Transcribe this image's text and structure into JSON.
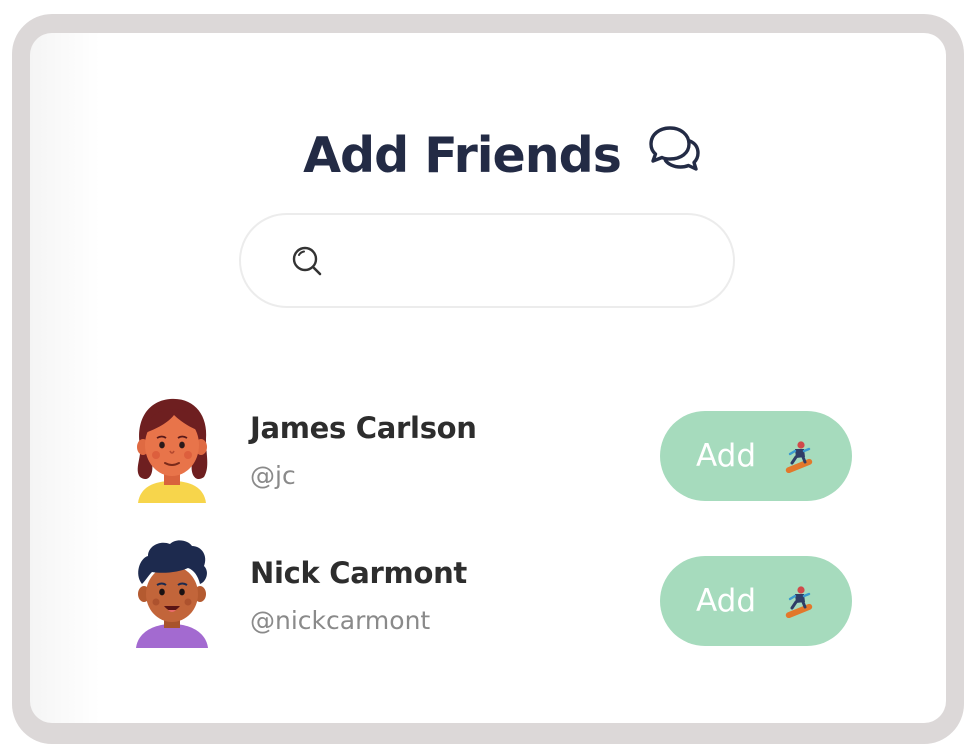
{
  "header": {
    "title": "Add Friends",
    "icon": "chat-bubbles-icon"
  },
  "search": {
    "placeholder": "",
    "value": "",
    "icon": "search-icon"
  },
  "friends": [
    {
      "name": "James Carlson",
      "handle": "@jc",
      "add_label": "Add",
      "avatar": "woman-avatar"
    },
    {
      "name": "Nick Carmont",
      "handle": "@nickcarmont",
      "add_label": "Add",
      "avatar": "man-avatar"
    }
  ],
  "colors": {
    "title": "#232b45",
    "button_bg": "#a6dbbd",
    "frame": "#dcd8d8",
    "handle_text": "#8a8a8a"
  }
}
